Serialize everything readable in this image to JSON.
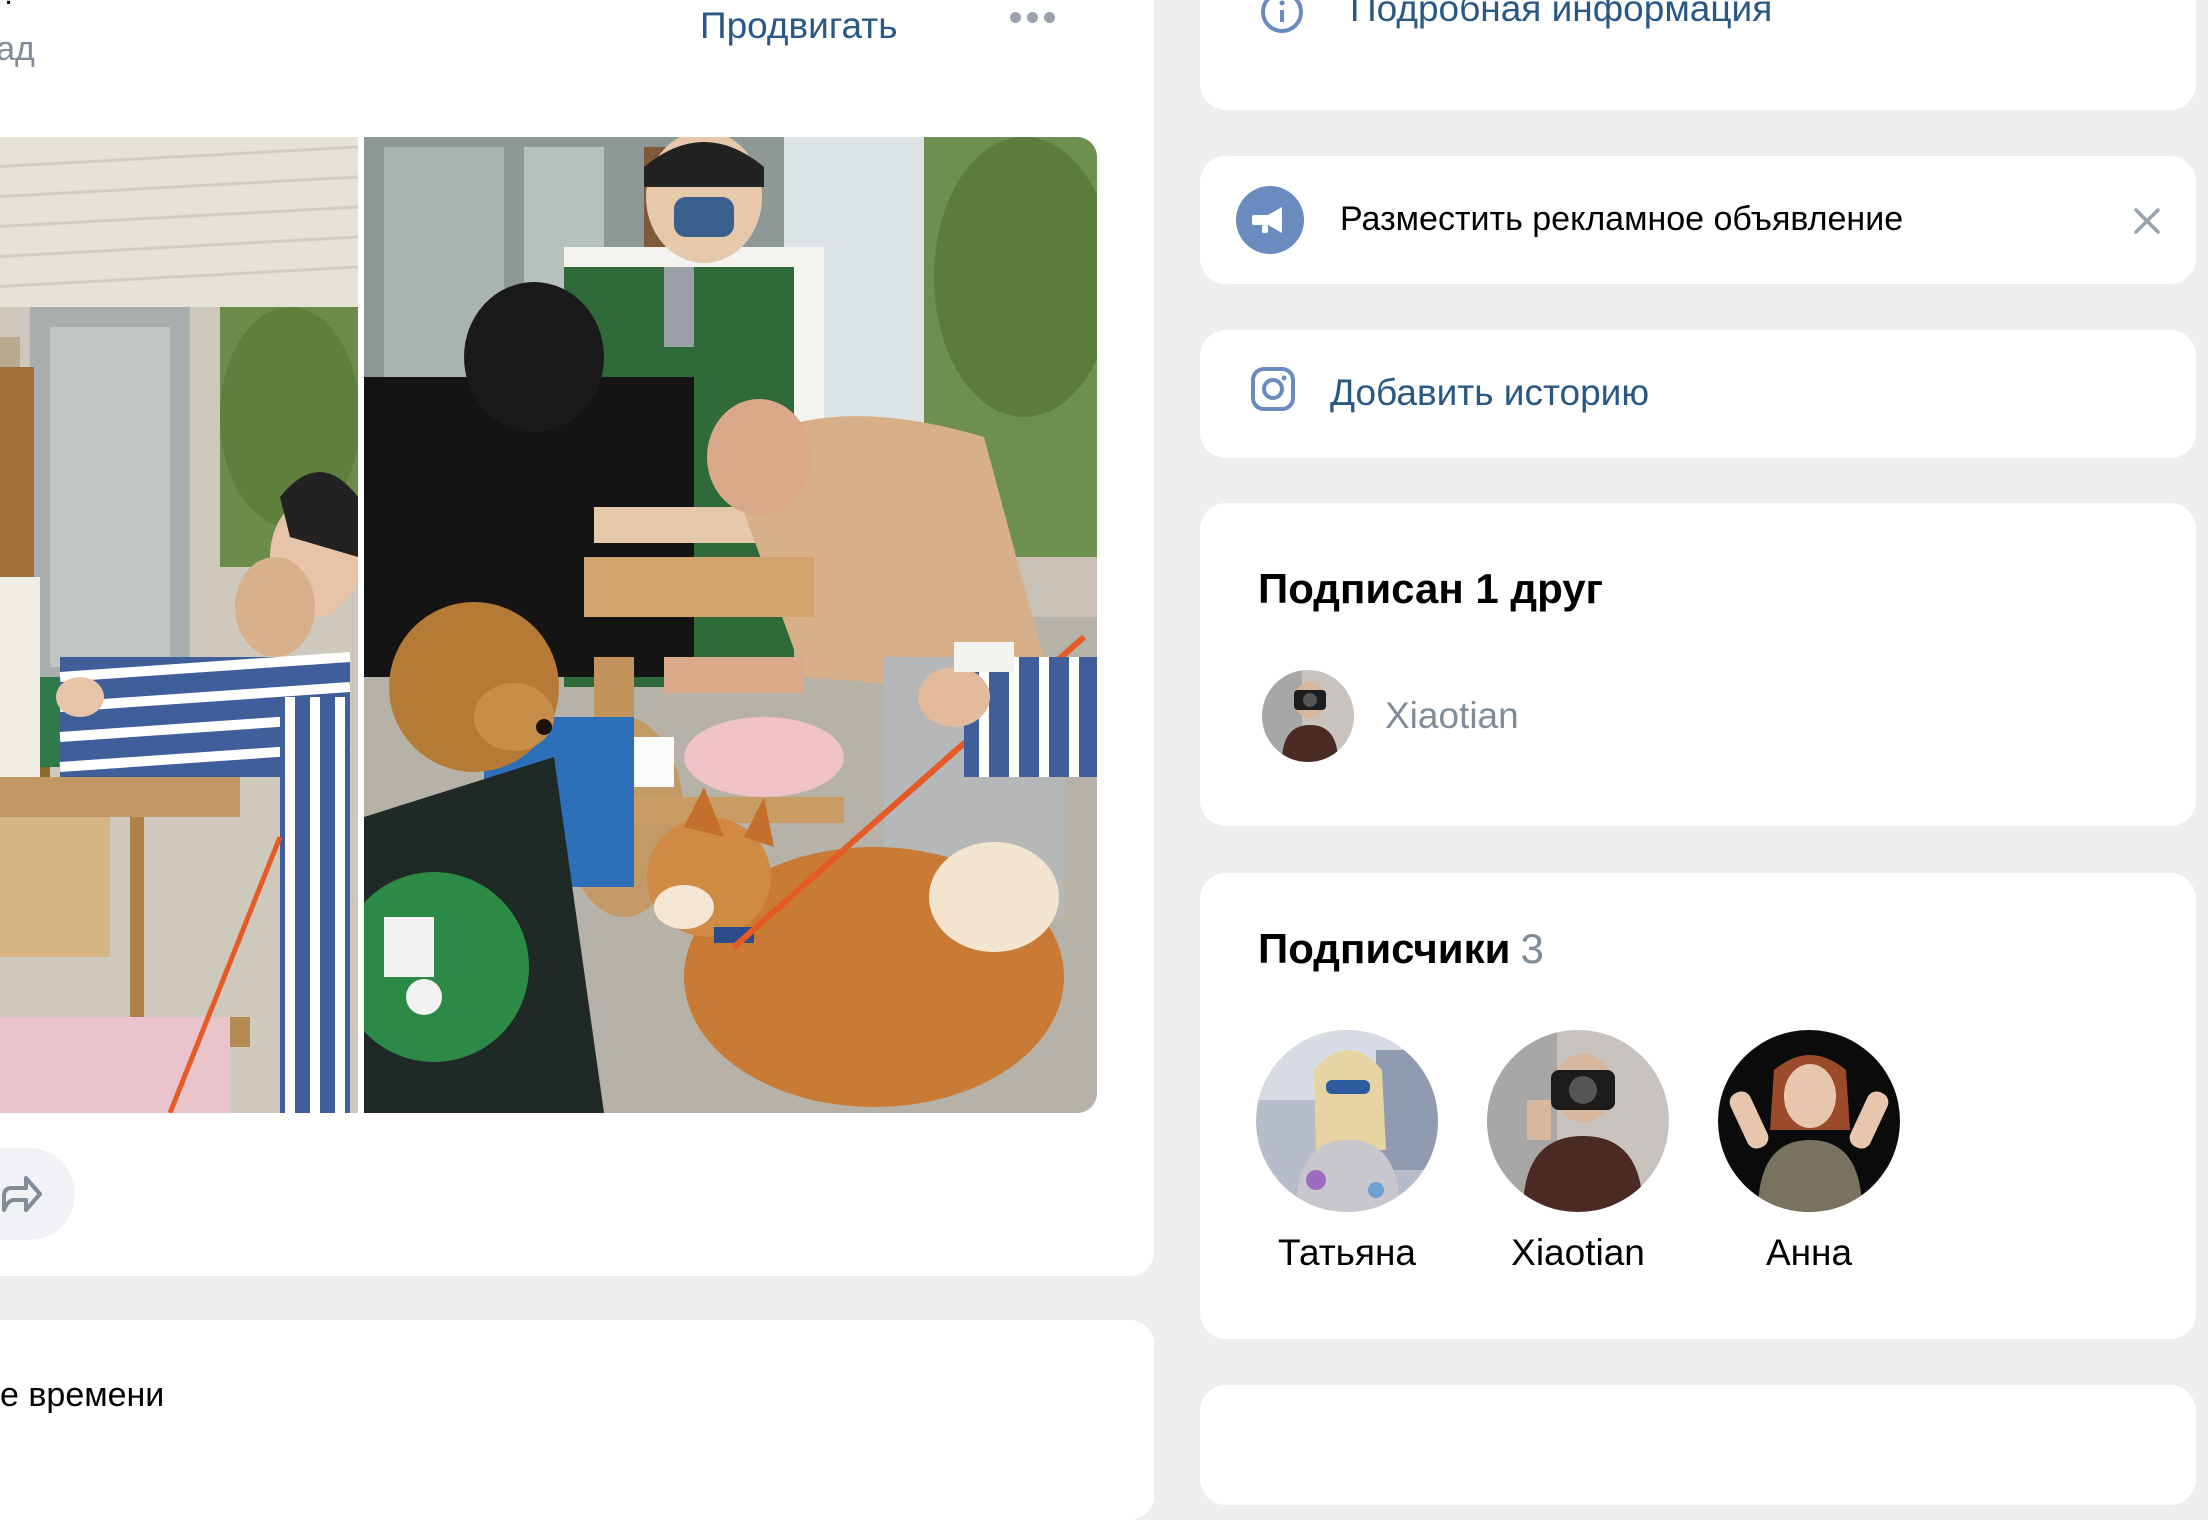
{
  "post": {
    "author_fragment": "..",
    "back_label": "азад",
    "promote_label": "Продвигать",
    "more_icon": "more-dots-icon",
    "share_icon": "share-icon",
    "photos": [
      {
        "subject": "people serving drinks at a cart outdoors"
      },
      {
        "subject": "man serving water to a shiba inu dog at a cart"
      }
    ]
  },
  "next_post": {
    "text_fragment": "е времени"
  },
  "sidebar": {
    "info_label": "Подробная информация",
    "ad": {
      "label": "Разместить рекламное объявление",
      "icon": "megaphone-icon",
      "close_icon": "close-icon"
    },
    "story": {
      "label": "Добавить историю",
      "icon": "camera-icon"
    },
    "friends": {
      "title": "Подписан 1 друг",
      "items": [
        {
          "name": "Xiaotian"
        }
      ]
    },
    "followers": {
      "title": "Подписчики",
      "count": "3",
      "items": [
        {
          "name": "Татьяна"
        },
        {
          "name": "Xiaotian"
        },
        {
          "name": "Анна"
        }
      ]
    }
  },
  "colors": {
    "background": "#edeef0",
    "card": "#ffffff",
    "link": "#2a5885",
    "secondary_text": "#818c99",
    "ad_icon_bg": "#6a8bc0"
  }
}
